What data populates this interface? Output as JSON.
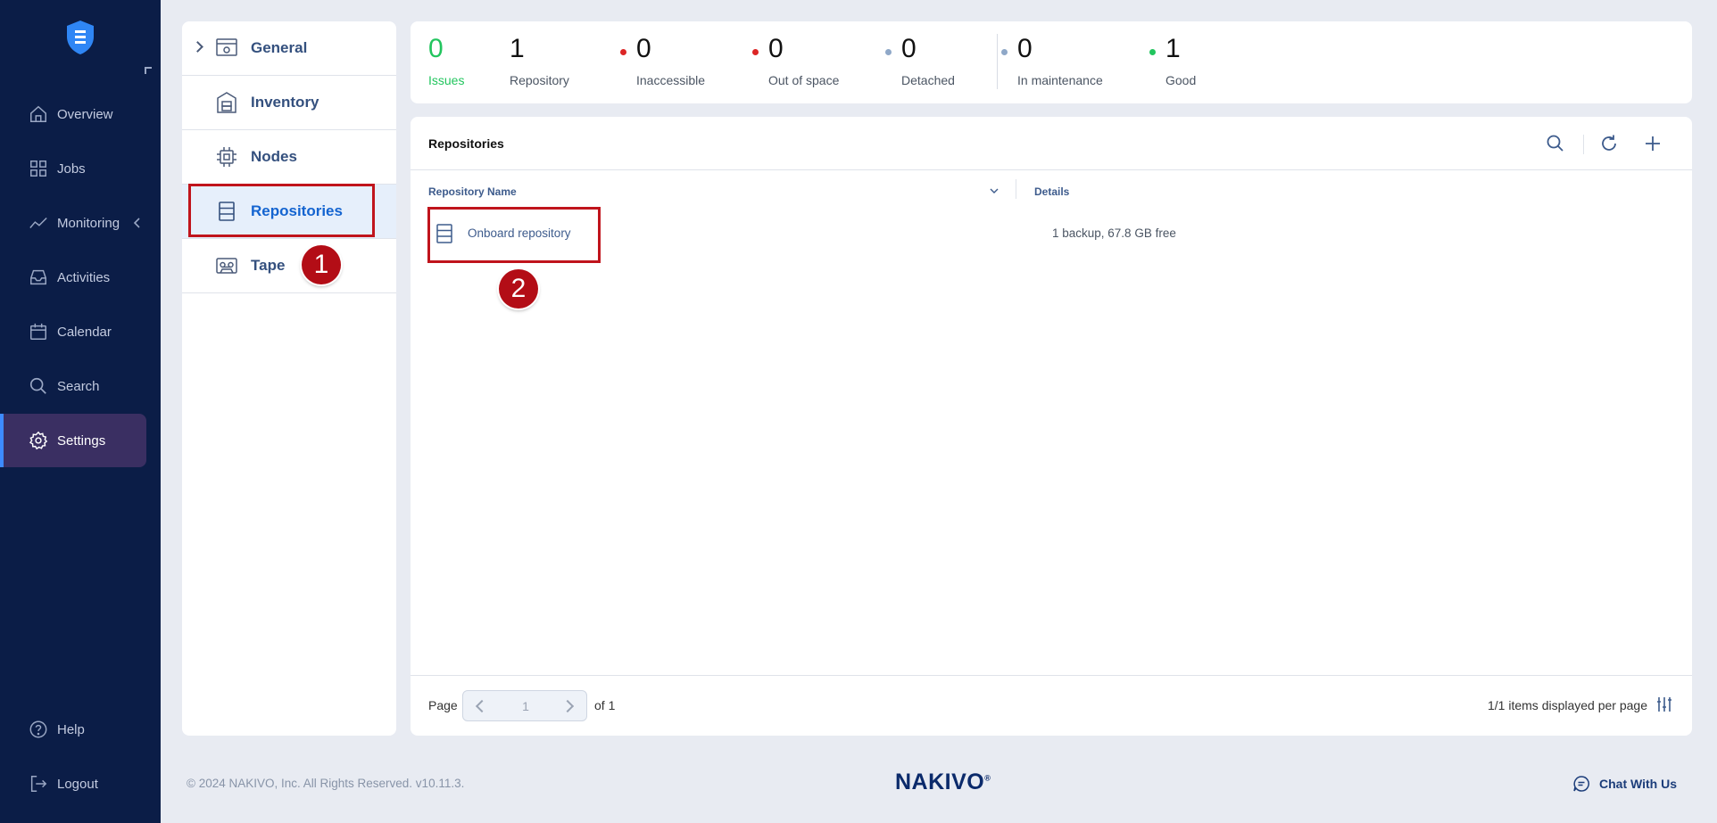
{
  "nav": {
    "items": [
      {
        "label": "Overview",
        "icon": "home-icon"
      },
      {
        "label": "Jobs",
        "icon": "grid-icon"
      },
      {
        "label": "Monitoring",
        "icon": "activity-line-icon"
      },
      {
        "label": "Activities",
        "icon": "inbox-icon"
      },
      {
        "label": "Calendar",
        "icon": "calendar-icon"
      },
      {
        "label": "Search",
        "icon": "search-icon"
      },
      {
        "label": "Settings",
        "icon": "gear-icon"
      }
    ],
    "bottom": [
      {
        "label": "Help",
        "icon": "help-icon"
      },
      {
        "label": "Logout",
        "icon": "logout-icon"
      }
    ],
    "active": "Settings"
  },
  "submenu": {
    "items": [
      {
        "label": "General",
        "icon": "general-settings-icon"
      },
      {
        "label": "Inventory",
        "icon": "inventory-icon"
      },
      {
        "label": "Nodes",
        "icon": "chip-icon"
      },
      {
        "label": "Repositories",
        "icon": "repository-icon"
      },
      {
        "label": "Tape",
        "icon": "tape-icon"
      }
    ],
    "active": "Repositories"
  },
  "stats": [
    {
      "value": "0",
      "label": "Issues",
      "color": "#22c55e"
    },
    {
      "value": "1",
      "label": "Repository"
    },
    {
      "value": "0",
      "label": "Inaccessible",
      "dot": "#dc2626"
    },
    {
      "value": "0",
      "label": "Out of space",
      "dot": "#dc2626"
    },
    {
      "value": "0",
      "label": "Detached",
      "dot": "#8fa8c8"
    },
    {
      "value": "0",
      "label": "In maintenance",
      "dot": "#8fa8c8"
    },
    {
      "value": "1",
      "label": "Good",
      "dot": "#22c55e"
    }
  ],
  "panel": {
    "title": "Repositories",
    "columns": {
      "name": "Repository Name",
      "details": "Details"
    },
    "rows": [
      {
        "name": "Onboard repository",
        "details": "1 backup, 67.8 GB free"
      }
    ],
    "pagination": {
      "page_label": "Page",
      "current_page": "1",
      "of_label": "of 1",
      "per_page_text": "1/1 items displayed per page"
    }
  },
  "annotations": [
    "1",
    "2"
  ],
  "footer": {
    "copyright": "© 2024 NAKIVO, Inc. All Rights Reserved. v10.11.3.",
    "brand": "NAKIVO",
    "brand_mark": "®",
    "chat": "Chat With Us"
  },
  "colors": {
    "nav_bg": "#0b1d47",
    "accent": "#1464d0",
    "annotation": "#c0141c"
  }
}
